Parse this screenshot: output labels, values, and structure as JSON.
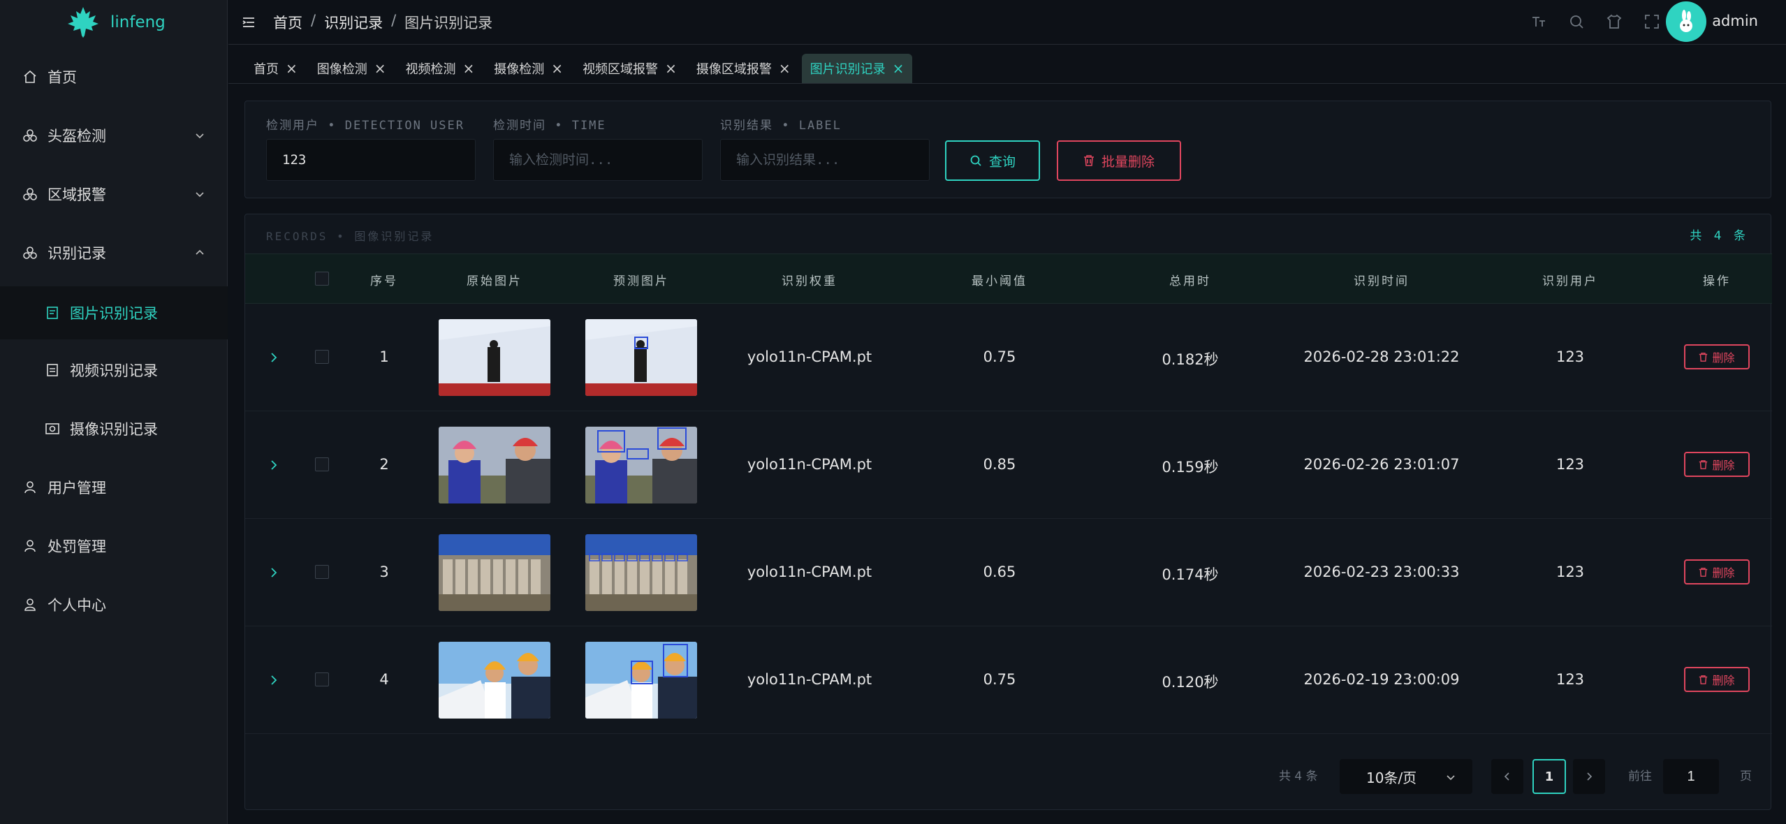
{
  "app": {
    "name": "linfeng",
    "user": "admin"
  },
  "sidebar": {
    "items": [
      {
        "label": "首页",
        "icon": "home-icon"
      },
      {
        "label": "头盔检测",
        "icon": "helmet-icon"
      },
      {
        "label": "区域报警",
        "icon": "alarm-icon"
      },
      {
        "label": "识别记录",
        "icon": "record-icon"
      },
      {
        "label": "图片识别记录",
        "icon": "image-record-icon"
      },
      {
        "label": "视频识别记录",
        "icon": "video-record-icon"
      },
      {
        "label": "摄像识别记录",
        "icon": "camera-record-icon"
      },
      {
        "label": "用户管理",
        "icon": "user-icon"
      },
      {
        "label": "处罚管理",
        "icon": "penalty-icon"
      },
      {
        "label": "个人中心",
        "icon": "profile-icon"
      }
    ]
  },
  "breadcrumb": [
    "首页",
    "识别记录",
    "图片识别记录"
  ],
  "tabs": [
    "首页",
    "图像检测",
    "视频检测",
    "摄像检测",
    "视频区域报警",
    "摄像区域报警",
    "图片识别记录"
  ],
  "filter": {
    "user_label": "检测用户 • DETECTION USER",
    "time_label": "检测时间 • TIME",
    "result_label": "识别结果 • LABEL",
    "user_value": "123",
    "time_placeholder": "输入检测时间...",
    "result_placeholder": "输入识别结果...",
    "query_label": "查询",
    "batch_delete_label": "批量删除"
  },
  "table": {
    "records_label": "RECORDS • 图像识别记录",
    "count_label": "共 4 条",
    "columns": [
      "序号",
      "原始图片",
      "预测图片",
      "识别权重",
      "最小阈值",
      "总用时",
      "识别时间",
      "识别用户",
      "操作"
    ],
    "rows": [
      {
        "index": "1",
        "weight": "yolo11n-CPAM.pt",
        "threshold": "0.75",
        "duration": "0.182秒",
        "time": "2026-02-28 23:01:22",
        "user": "123",
        "action": "删除"
      },
      {
        "index": "2",
        "weight": "yolo11n-CPAM.pt",
        "threshold": "0.85",
        "duration": "0.159秒",
        "time": "2026-02-26 23:01:07",
        "user": "123",
        "action": "删除"
      },
      {
        "index": "3",
        "weight": "yolo11n-CPAM.pt",
        "threshold": "0.65",
        "duration": "0.174秒",
        "time": "2026-02-23 23:00:33",
        "user": "123",
        "action": "删除"
      },
      {
        "index": "4",
        "weight": "yolo11n-CPAM.pt",
        "threshold": "0.75",
        "duration": "0.120秒",
        "time": "2026-02-19 23:00:09",
        "user": "123",
        "action": "删除"
      }
    ]
  },
  "pagination": {
    "total_label": "共 4 条",
    "page_size": "10条/页",
    "current_page": "1",
    "goto_label": "前往",
    "goto_value": "1",
    "page_suffix": "页"
  },
  "colors": {
    "accent": "#2fd3c1",
    "danger": "#e0465e",
    "background": "#0d1117"
  }
}
